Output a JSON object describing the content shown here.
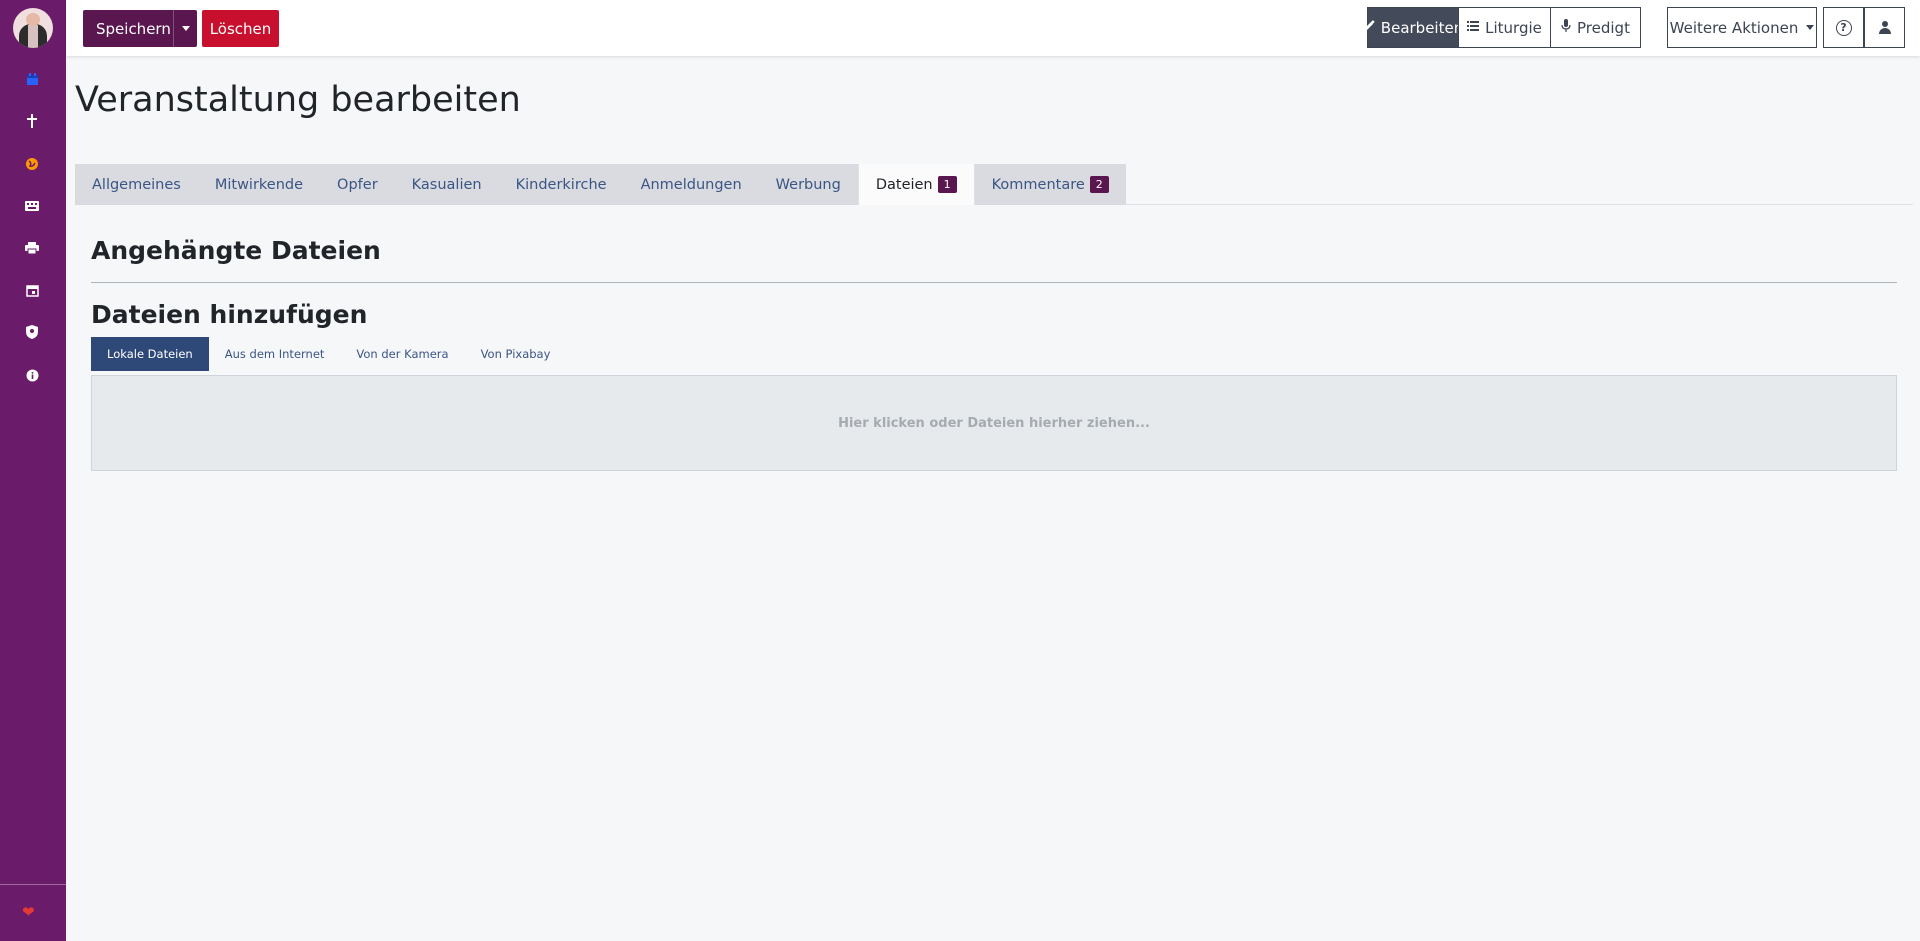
{
  "toolbar": {
    "save_label": "Speichern",
    "delete_label": "Löschen",
    "edit_label": "Bearbeiten",
    "liturgy_label": "Liturgie",
    "sermon_label": "Predigt",
    "more_label": "Weitere Aktionen"
  },
  "page": {
    "title": "Veranstaltung bearbeiten"
  },
  "tabs": [
    {
      "label": "Allgemeines"
    },
    {
      "label": "Mitwirkende"
    },
    {
      "label": "Opfer"
    },
    {
      "label": "Kasualien"
    },
    {
      "label": "Kinderkirche"
    },
    {
      "label": "Anmeldungen"
    },
    {
      "label": "Werbung"
    },
    {
      "label": "Dateien",
      "badge": "1"
    },
    {
      "label": "Kommentare",
      "badge": "2"
    }
  ],
  "files": {
    "attached_heading": "Angehängte Dateien",
    "add_heading": "Dateien hinzufügen",
    "sources": [
      "Lokale Dateien",
      "Aus dem Internet",
      "Von der Kamera",
      "Von Pixabay"
    ],
    "dropzone_text": "Hier klicken oder Dateien hierher ziehen..."
  },
  "colors": {
    "sidebar": "#6a1b6a",
    "primary": "#5a164f",
    "danger": "#c8102e",
    "active_source": "#2e4878"
  }
}
